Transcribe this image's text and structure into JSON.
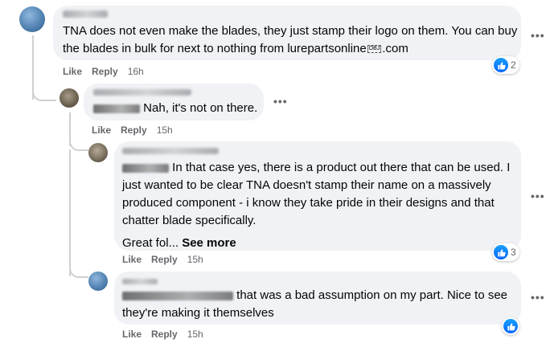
{
  "comments": [
    {
      "text_a": "TNA does not even make the blades, they just stamp their logo on them. You can buy",
      "text_b_pre": "the blades in bulk for next to nothing from lurepartsonline",
      "text_b_glyph": "OBJ",
      "text_b_post": ".com",
      "like": "Like",
      "reply": "Reply",
      "time": "16h",
      "reaction_count": "2"
    },
    {
      "text": "Nah, it's not on there.",
      "like": "Like",
      "reply": "Reply",
      "time": "15h"
    },
    {
      "line1": "In that case yes, there is a product out there that can be used. I",
      "line2": "just wanted to be clear TNA doesn't stamp their name on a massively",
      "line3": "produced component - i know they take pride in their designs and that",
      "line4": "chatter blade specifically.",
      "line5": "Great fol...",
      "see_more": "See more",
      "like": "Like",
      "reply": "Reply",
      "time": "15h",
      "reaction_count": "3"
    },
    {
      "line1": "that was a bad assumption on my part. Nice to see",
      "line2": "they're making it themselves",
      "like": "Like",
      "reply": "Reply",
      "time": "15h"
    }
  ],
  "more_icon": "•••",
  "colors": {
    "bubble": "#f0f2f5",
    "meta": "#65676b",
    "like_blue": "#0866ff"
  }
}
